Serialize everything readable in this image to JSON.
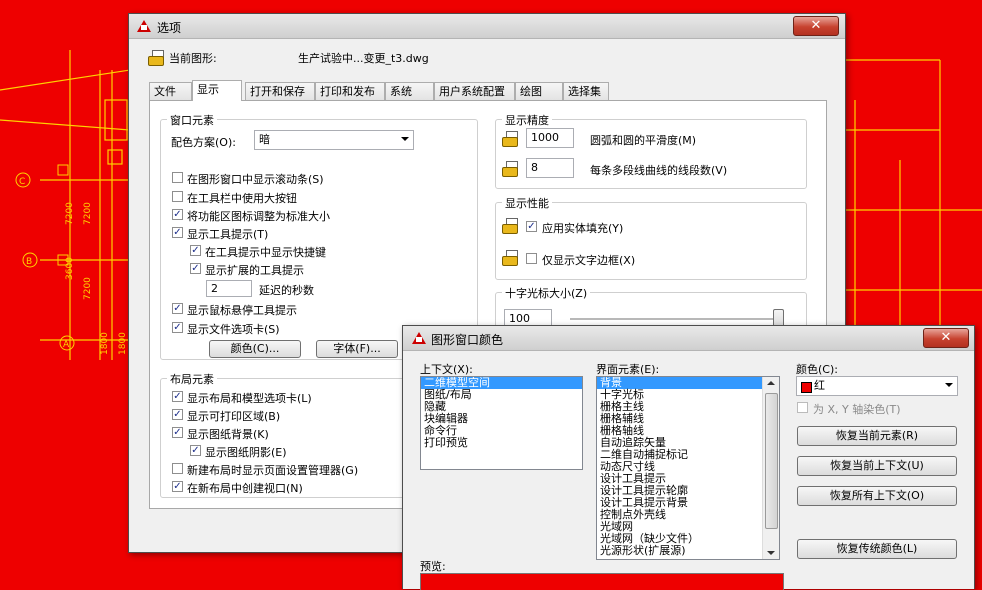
{
  "colors": {
    "background_red": "#ee0000",
    "cad_lines": "#ffd200",
    "selection": "#3399ff"
  },
  "options": {
    "title": "选项",
    "close_glyph": "✕",
    "current_drawing_label": "当前图形:",
    "current_drawing_value": "生产试验中...变更_t3.dwg",
    "tabs": [
      "文件",
      "显示",
      "打开和保存",
      "打印和发布",
      "系统",
      "用户系统配置",
      "绘图",
      "选择集"
    ],
    "window_elements": {
      "title": "窗口元素",
      "color_scheme_label": "配色方案(O):",
      "color_scheme_value": "暗",
      "checkboxes": [
        {
          "label": "在图形窗口中显示滚动条(S)",
          "checked": ""
        },
        {
          "label": "在工具栏中使用大按钮",
          "checked": ""
        },
        {
          "label": "将功能区图标调整为标准大小",
          "checked": "✓"
        },
        {
          "label": "显示工具提示(T)",
          "checked": "✓"
        },
        {
          "label": "在工具提示中显示快捷键",
          "checked": "✓"
        },
        {
          "label": "显示扩展的工具提示",
          "checked": "✓"
        },
        {
          "label": "显示鼠标悬停工具提示",
          "checked": "✓"
        },
        {
          "label": "显示文件选项卡(S)",
          "checked": "✓"
        }
      ],
      "delay_value": "2",
      "delay_label": "延迟的秒数",
      "colors_button": "颜色(C)...",
      "fonts_button": "字体(F)..."
    },
    "layout_elements": {
      "title": "布局元素",
      "checkboxes": [
        {
          "label": "显示布局和模型选项卡(L)",
          "checked": "✓"
        },
        {
          "label": "显示可打印区域(B)",
          "checked": "✓"
        },
        {
          "label": "显示图纸背景(K)",
          "checked": "✓"
        },
        {
          "label": "显示图纸阴影(E)",
          "checked": "✓"
        },
        {
          "label": "新建布局时显示页面设置管理器(G)",
          "checked": ""
        },
        {
          "label": "在新布局中创建视口(N)",
          "checked": "✓"
        }
      ]
    },
    "display_resolution": {
      "title": "显示精度",
      "arc_value": "1000",
      "arc_label": "圆弧和圆的平滑度(M)",
      "segments_value": "8",
      "segments_label": "每条多段线曲线的线段数(V)"
    },
    "display_performance": {
      "title": "显示性能",
      "solid_fill_label": "应用实体填充(Y)",
      "solid_fill_checked": "✓",
      "text_frame_label": "仅显示文字边框(X)",
      "text_frame_checked": ""
    },
    "crosshair": {
      "title": "十字光标大小(Z)",
      "value": "100",
      "level": 1.0
    }
  },
  "drawing_window_colors": {
    "title": "图形窗口颜色",
    "close_glyph": "✕",
    "context_label": "上下文(X):",
    "contexts": [
      "二维模型空间",
      "图纸/布局",
      "隐藏",
      "块编辑器",
      "命令行",
      "打印预览"
    ],
    "interface_label": "界面元素(E):",
    "elements": [
      "背景",
      "十字光标",
      "栅格主线",
      "栅格辅线",
      "栅格轴线",
      "自动追踪矢量",
      "二维自动捕捉标记",
      "动态尺寸线",
      "设计工具提示",
      "设计工具提示轮廓",
      "设计工具提示背景",
      "控制点外壳线",
      "光域网",
      "光域网（缺少文件）",
      "光源形状(扩展源)"
    ],
    "color_label": "颜色(C):",
    "color_value": "红",
    "color_swatch": "#ee0000",
    "tint_label": "为 X, Y 轴染色(T)",
    "buttons": [
      "恢复当前元素(R)",
      "恢复当前上下文(U)",
      "恢复所有上下文(O)",
      "恢复传统颜色(L)"
    ],
    "preview_label": "预览:"
  },
  "cad": {
    "dim_labels": [
      "7200",
      "7200",
      "3600",
      "7200",
      "1800",
      "1800"
    ],
    "grid_markers": [
      "C",
      "B",
      "A"
    ]
  }
}
